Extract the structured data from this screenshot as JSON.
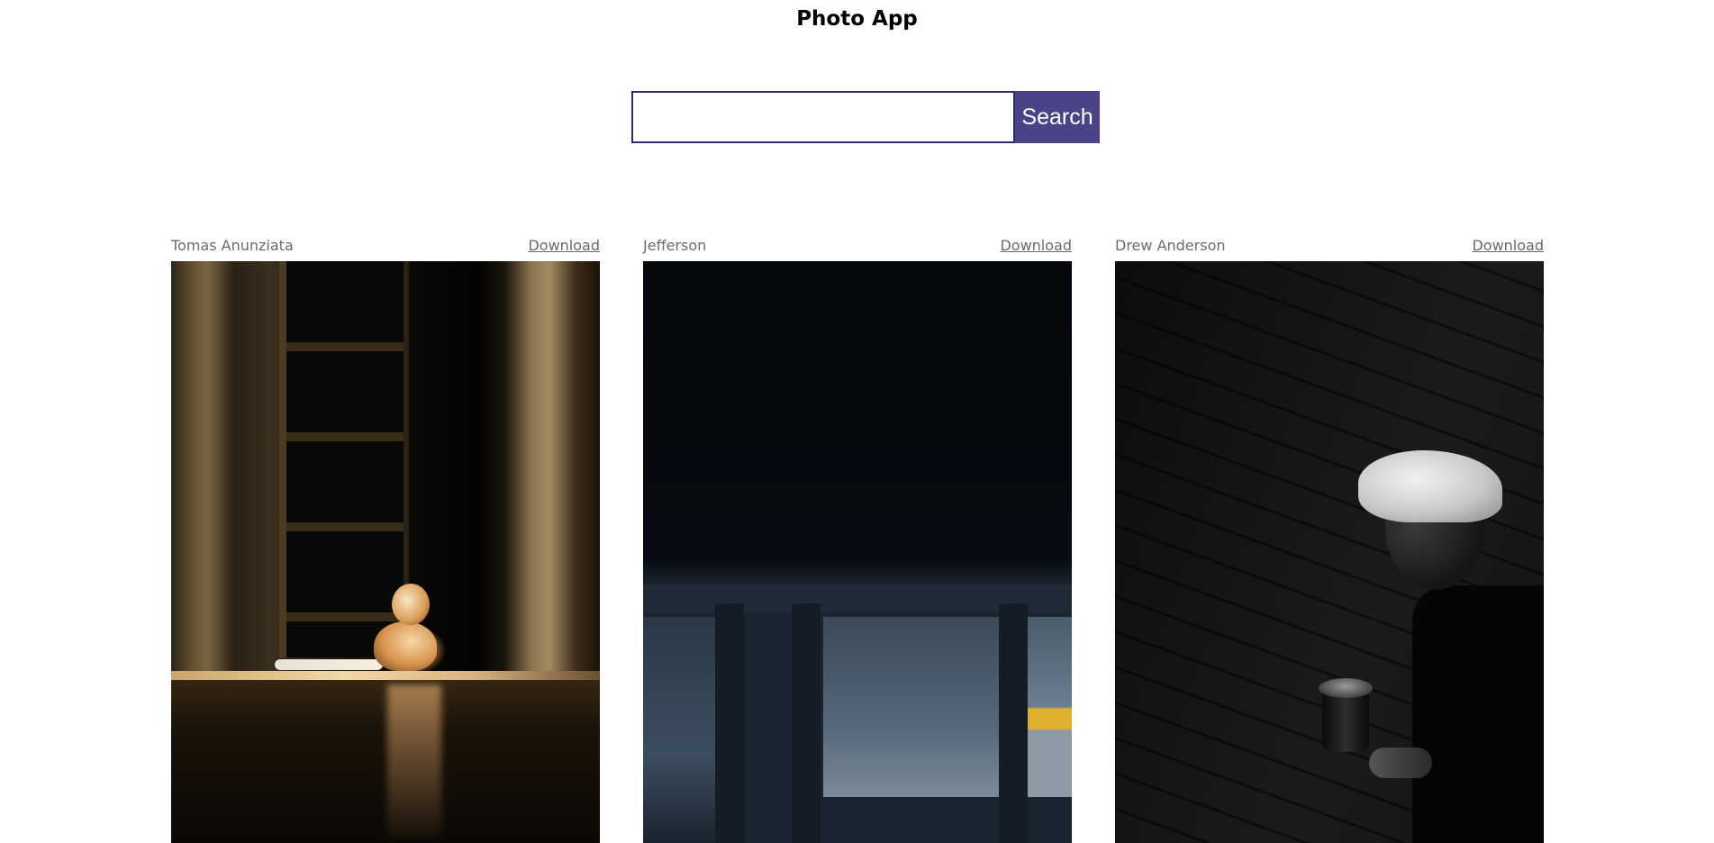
{
  "app": {
    "title": "Photo App"
  },
  "search": {
    "value": "",
    "placeholder": "",
    "button_label": "Search"
  },
  "photos": [
    {
      "author": "Tomas Anunziata",
      "download_label": "Download",
      "subject": "cat-in-doorway"
    },
    {
      "author": "Jefferson",
      "download_label": "Download",
      "subject": "dark-architecture"
    },
    {
      "author": "Drew Anderson",
      "download_label": "Download",
      "subject": "man-in-cap-with-coffee"
    }
  ],
  "colors": {
    "accent": "#4b4387",
    "input_border": "#2e2a6b",
    "meta_text": "#6b6b6b"
  }
}
